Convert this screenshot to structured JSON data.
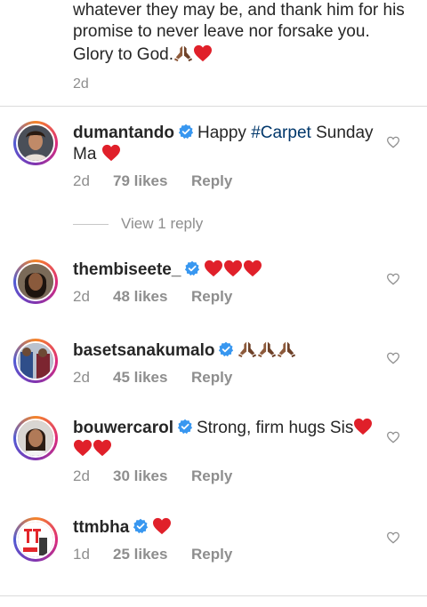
{
  "caption": {
    "text": "whatever they may be, and thank him for his promise to never leave nor forsake you. Glory to God.",
    "time": "2d"
  },
  "comments": [
    {
      "username": "dumantando",
      "text_before": "Happy ",
      "hashtag": "#Carpet",
      "text_after": " Sunday Ma",
      "time": "2d",
      "likes": "79 likes",
      "reply": "Reply"
    },
    {
      "username": "thembiseete_",
      "text": "",
      "time": "2d",
      "likes": "48 likes",
      "reply": "Reply"
    },
    {
      "username": "basetsanakumalo",
      "text": "",
      "time": "2d",
      "likes": "45 likes",
      "reply": "Reply"
    },
    {
      "username": "bouwercarol",
      "text": "Strong, firm hugs Sis",
      "time": "2d",
      "likes": "30 likes",
      "reply": "Reply"
    },
    {
      "username": "ttmbha",
      "text": "",
      "time": "1d",
      "likes": "25 likes",
      "reply": "Reply"
    }
  ],
  "view_replies": "View 1 reply",
  "colors": {
    "text": "#262626",
    "muted": "#8e8e8e",
    "hashtag": "#00376b",
    "verified": "#3897f0",
    "heart": "#ed1c24"
  },
  "icons": [
    "pray-icon",
    "red-heart-icon",
    "verified-badge-icon",
    "like-heart-icon"
  ]
}
